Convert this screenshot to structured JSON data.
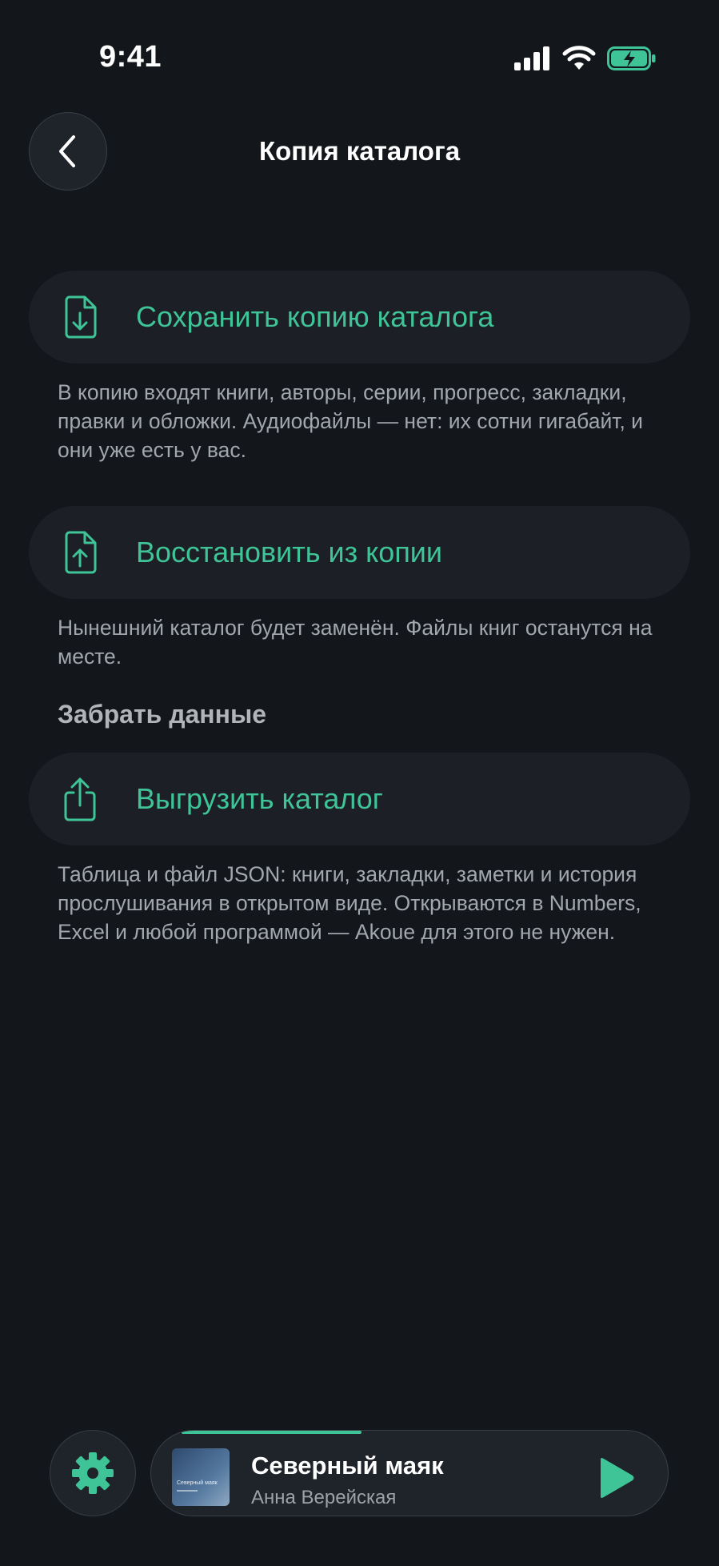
{
  "status_bar": {
    "time": "9:41"
  },
  "header": {
    "title": "Копия каталога"
  },
  "actions": {
    "save": {
      "label": "Сохранить копию каталога",
      "icon": "file-download-icon",
      "description": "В копию входят книги, авторы, серии, прогресс, закладки, правки и обложки. Аудиофайлы — нет: их сотни гигабайт, и они уже есть у вас."
    },
    "restore": {
      "label": "Восстановить из копии",
      "icon": "file-upload-icon",
      "description": "Нынешний каталог будет заменён. Файлы книг останутся на месте."
    }
  },
  "export_section": {
    "title": "Забрать данные",
    "export": {
      "label": "Выгрузить каталог",
      "icon": "share-icon",
      "description": "Таблица и файл JSON: книги, закладки, заметки и история прослушивания в открытом виде. Открываются в Numbers, Excel и любой программой — Akoue для этого не нужен."
    }
  },
  "mini_player": {
    "title": "Северный маяк",
    "author": "Анна Верейская",
    "cover_text": "Северный маяк",
    "progress": 0.37
  },
  "colors": {
    "background": "#13161b",
    "accent": "#3ec497",
    "card": "#1c2026",
    "muted_text": "#a2a6ad"
  }
}
